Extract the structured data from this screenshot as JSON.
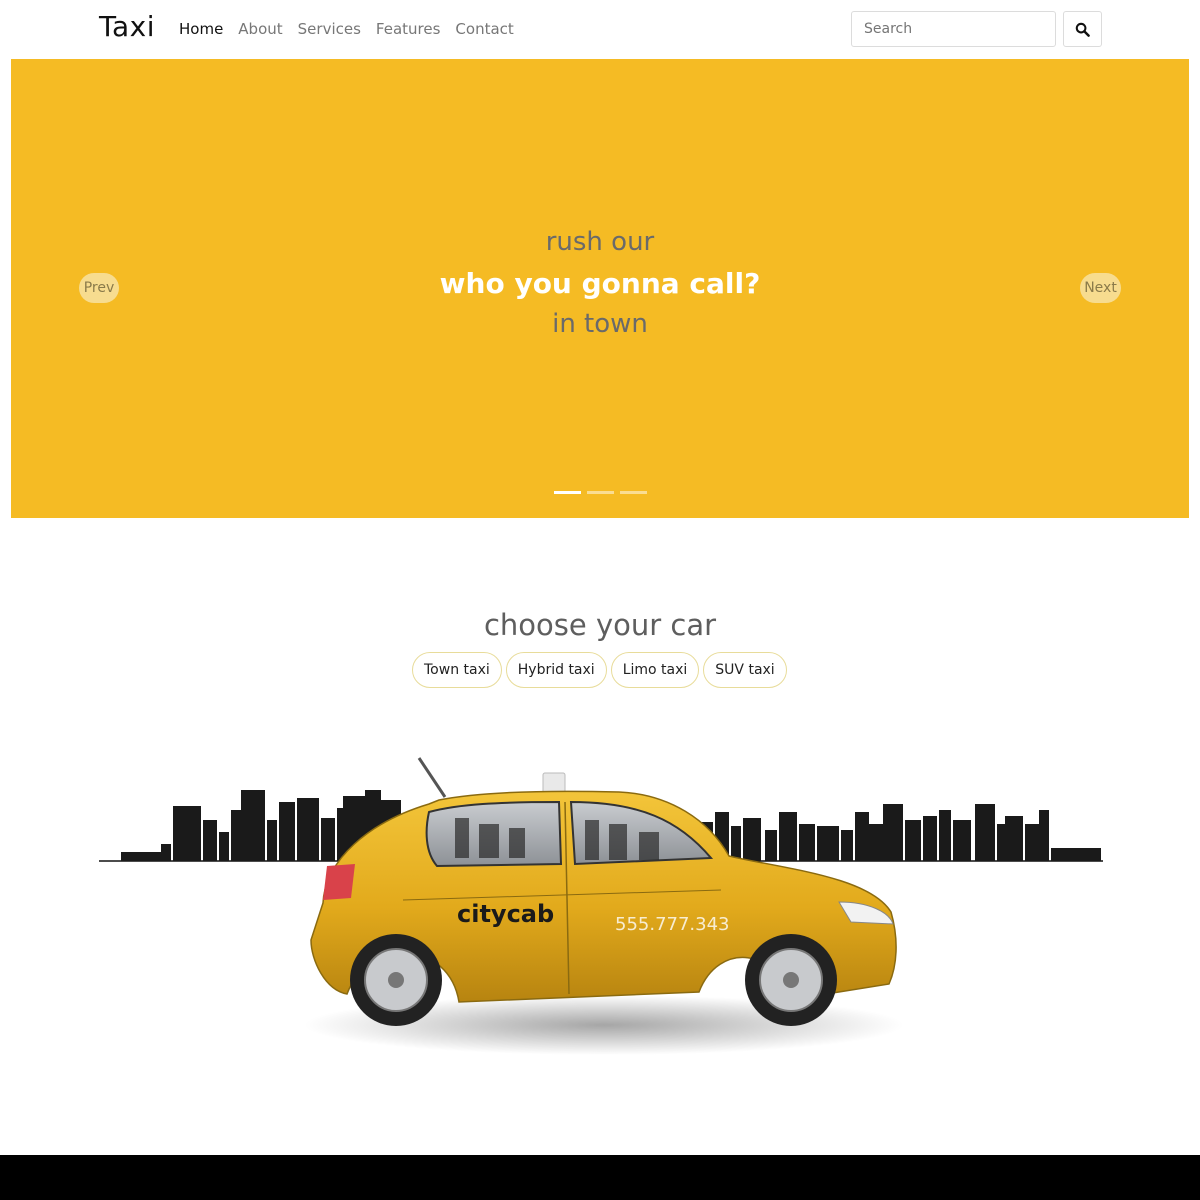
{
  "navbar": {
    "brand": "Taxi",
    "links": [
      "Home",
      "About",
      "Services",
      "Features",
      "Contact"
    ],
    "search_placeholder": "Search",
    "search_icon": "search-icon"
  },
  "hero": {
    "line1": "rush our",
    "line2": "who you gonna call?",
    "line3": "in town",
    "prev_label": "Prev",
    "next_label": "Next",
    "slide_count": 3,
    "active_slide": 1,
    "background_color": "#f5bb24"
  },
  "cars": {
    "title": "choose your car",
    "options": [
      "Town taxi",
      "Hybrid taxi",
      "Limo taxi",
      "SUV taxi"
    ]
  },
  "car_image": {
    "brand_text": "citycab",
    "phone": "555.777.343",
    "body_color": "#e8b526"
  },
  "footer": {
    "background_color": "#000000"
  }
}
